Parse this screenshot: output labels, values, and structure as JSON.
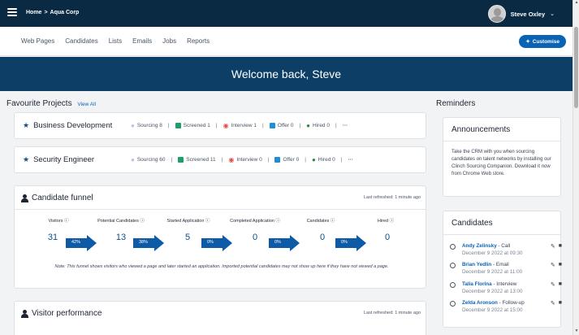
{
  "topbar": {
    "breadcrumb": [
      "Home",
      ">",
      "Aqua Corp"
    ],
    "username": "Steve Oxley"
  },
  "nav": {
    "links": [
      "Web Pages",
      "Candidates",
      "Lists",
      "Emails",
      "Jobs",
      "Reports"
    ],
    "customise_label": "Customise"
  },
  "hero": {
    "title": "Welcome back, Steve"
  },
  "favourites": {
    "title": "Favourite Projects",
    "view_all": "View All",
    "projects": [
      {
        "name": "Business Development",
        "stats": [
          "Sourcing 8",
          "Screened 1",
          "Interview 1",
          "Offer 0",
          "Hired 0"
        ],
        "more": "···"
      },
      {
        "name": "Security Engineer",
        "stats": [
          "Sourcing 60",
          "Screened 11",
          "Interview 0",
          "Offer 0",
          "Hired 0"
        ],
        "more": "···"
      }
    ],
    "colors": {
      "sourcing": "#b9bff0",
      "screened": "#1c9f6a",
      "interview": "#e24b4b",
      "offer": "#1e8fd6",
      "hired": "#2e8b3a"
    }
  },
  "funnel": {
    "title": "Candidate funnel",
    "refreshed": "Last refreshed: 1 minute ago",
    "stages": [
      {
        "label": "Visitors ⓘ",
        "value": "31"
      },
      {
        "label": "Potential Candidates ⓘ",
        "value": "13"
      },
      {
        "label": "Started Application ⓘ",
        "value": "5"
      },
      {
        "label": "Completed Application ⓘ",
        "value": "0"
      },
      {
        "label": "Candidates ⓘ",
        "value": "0"
      },
      {
        "label": "Hired ⓘ",
        "value": "0"
      }
    ],
    "conversions": [
      "42%",
      "38%",
      "0%",
      "0%",
      "0%"
    ],
    "note": "Note: This funnel shows visitors who viewed a page and later started an application. Imported potential candidates may not show up here if they have not viewed a page."
  },
  "visitor": {
    "title": "Visitor performance",
    "refreshed": "Last refreshed: 1 minute ago"
  },
  "reminders": {
    "title": "Reminders",
    "announcements": {
      "title": "Announcements",
      "text": "Take the CRM with you when sourcing candidates on talent networks by installing our Clinch Sourcing Companion. Download it now from Chrome Web store."
    },
    "candidates": {
      "title": "Candidates",
      "items": [
        {
          "name": "Andy Zelinsky",
          "action": " - Call",
          "date": "December 9 2022 at 09:30"
        },
        {
          "name": "Brian Yedlin",
          "action": " - Email",
          "date": "December 9 2022 at 11:00"
        },
        {
          "name": "Talia Florina",
          "action": " - Interview",
          "date": "December 9 2022 at 13:00"
        },
        {
          "name": "Zelda Aronson",
          "action": " - Follow-up",
          "date": "December 9 2022 at 15:00"
        }
      ]
    }
  }
}
